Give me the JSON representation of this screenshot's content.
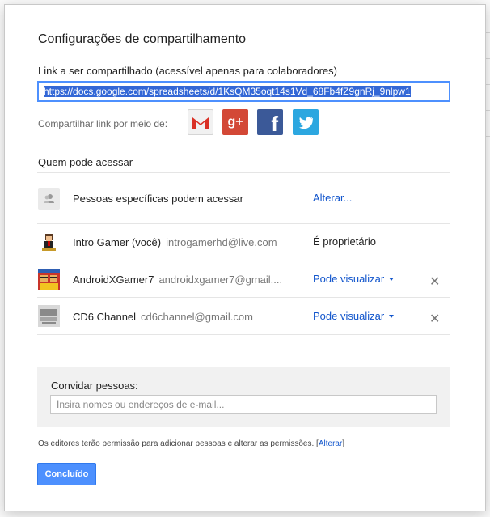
{
  "dialog": {
    "title": "Configurações de compartilhamento",
    "link_label": "Link a ser compartilhado (acessível apenas para colaboradores)",
    "link_value": "https://docs.google.com/spreadsheets/d/1KsQM35oqt14s1Vd_68Fb4fZ9gnRj_9nlpw1",
    "share_via_label": "Compartilhar link por meio de:",
    "share_icons": [
      "gmail-icon",
      "google-plus-icon",
      "facebook-icon",
      "twitter-icon"
    ],
    "who_label": "Quem pode acessar",
    "access_row": {
      "text": "Pessoas específicas podem acessar",
      "change_link": "Alterar..."
    },
    "people": [
      {
        "name": "Intro Gamer (você)",
        "email": "introgamerhd@live.com",
        "role": "É proprietário"
      },
      {
        "name": "AndroidXGamer7",
        "email": "androidxgamer7@gmail....",
        "role": "Pode visualizar"
      },
      {
        "name": "CD6 Channel",
        "email": "cd6channel@gmail.com",
        "role": "Pode visualizar"
      }
    ],
    "invite": {
      "label": "Convidar pessoas:",
      "placeholder": "Insira nomes ou endereços de e-mail..."
    },
    "editors_note": "Os editores terão permissão para adicionar pessoas e alterar as permissões.",
    "editors_note_link": "Alterar",
    "done_label": "Concluído"
  },
  "colors": {
    "accent": "#4d90fe",
    "link": "#1155cc"
  }
}
